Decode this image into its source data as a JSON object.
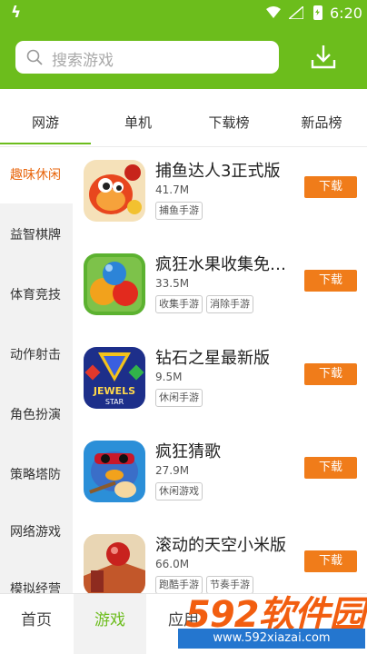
{
  "status_bar": {
    "app_glyph": "ϟ",
    "time": "6:20"
  },
  "search": {
    "placeholder": "搜索游戏"
  },
  "tabs": [
    {
      "label": "网游",
      "active": true
    },
    {
      "label": "单机",
      "active": false
    },
    {
      "label": "下载榜",
      "active": false
    },
    {
      "label": "新品榜",
      "active": false
    }
  ],
  "sidebar": {
    "items": [
      {
        "label": "趣味休闲",
        "active": true
      },
      {
        "label": "益智棋牌"
      },
      {
        "label": "体育竞技"
      },
      {
        "label": "动作射击"
      },
      {
        "label": "角色扮演"
      },
      {
        "label": "策略塔防"
      },
      {
        "label": "网络游戏"
      },
      {
        "label": "模拟经营"
      }
    ]
  },
  "games": [
    {
      "name": "捕鱼达人3正式版",
      "size": "41.7M",
      "tags": [
        "捕鱼手游"
      ],
      "download": "下载",
      "icon": "fish-game-icon"
    },
    {
      "name": "疯狂水果收集免…",
      "size": "33.5M",
      "tags": [
        "收集手游",
        "消除手游"
      ],
      "download": "下载",
      "icon": "fruit-game-icon"
    },
    {
      "name": "钻石之星最新版",
      "size": "9.5M",
      "tags": [
        "休闲手游"
      ],
      "download": "下载",
      "icon": "jewels-star-icon",
      "icon_text": [
        "JEWELS",
        "STAR"
      ]
    },
    {
      "name": "疯狂猜歌",
      "size": "27.9M",
      "tags": [
        "休闲游戏"
      ],
      "download": "下载",
      "icon": "guitar-bird-icon"
    },
    {
      "name": "滚动的天空小米版",
      "size": "66.0M",
      "tags": [
        "跑酷手游",
        "节奏手游"
      ],
      "download": "下载",
      "icon": "rolling-sky-icon"
    }
  ],
  "bottom_nav": [
    {
      "label": "首页",
      "active": false
    },
    {
      "label": "游戏",
      "active": true
    },
    {
      "label": "应用",
      "active": false
    }
  ],
  "watermark": {
    "brand_digits": "592",
    "brand_text": "软件园",
    "url": "www.592xiazai.com"
  },
  "colors": {
    "accent_green": "#6cbd1c",
    "download_orange": "#f07c1a",
    "active_category": "#e8660d"
  }
}
